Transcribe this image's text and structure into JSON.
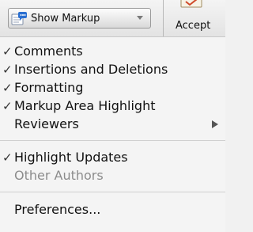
{
  "toolbar": {
    "markup_dropdown_label": "Show Markup",
    "accept_label": "Accept"
  },
  "menu": {
    "items": [
      {
        "label": "Comments",
        "checked": true,
        "enabled": true
      },
      {
        "label": "Insertions and Deletions",
        "checked": true,
        "enabled": true
      },
      {
        "label": "Formatting",
        "checked": true,
        "enabled": true
      },
      {
        "label": "Markup Area Highlight",
        "checked": true,
        "enabled": true
      },
      {
        "label": "Reviewers",
        "checked": false,
        "enabled": true,
        "submenu": true
      },
      {
        "label": "Highlight Updates",
        "checked": true,
        "enabled": true
      },
      {
        "label": "Other Authors",
        "checked": false,
        "enabled": false
      },
      {
        "label": "Preferences...",
        "checked": false,
        "enabled": true
      }
    ],
    "check_glyph": "✓"
  },
  "colors": {
    "text": "#111111",
    "disabled_text": "#8c8c8c",
    "icon_blue": "#2a6fd1"
  }
}
